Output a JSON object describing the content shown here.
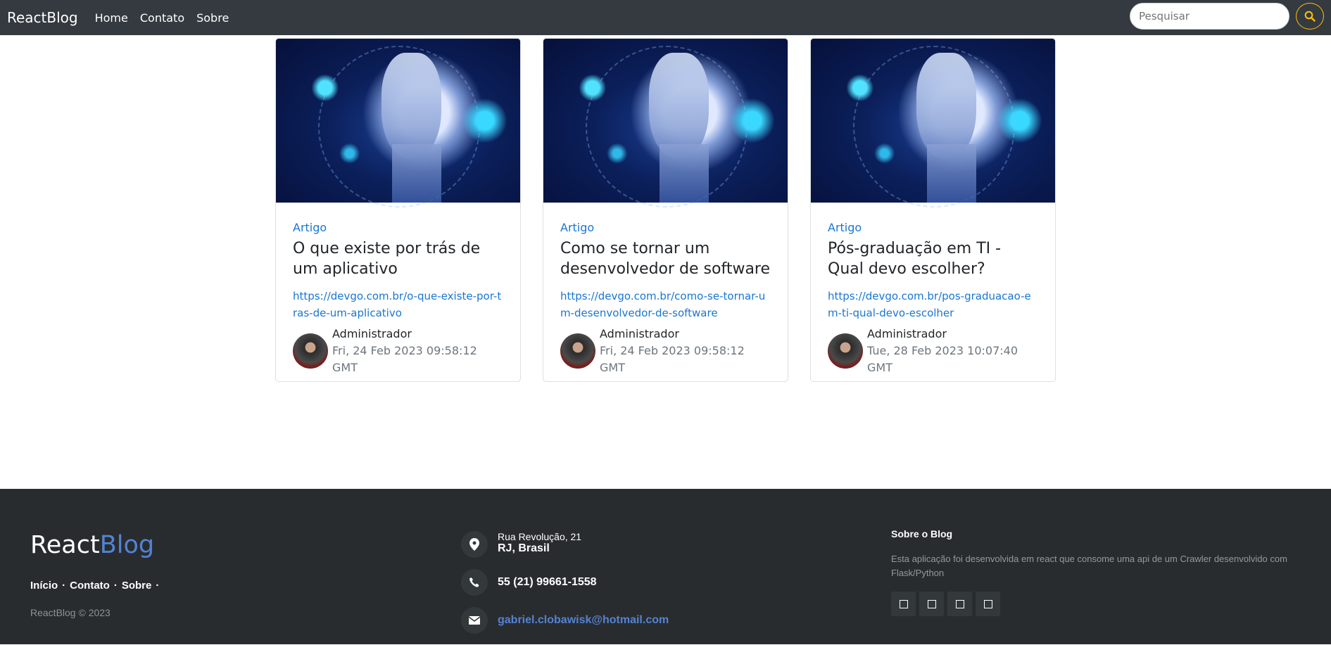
{
  "navbar": {
    "brand": "ReactBlog",
    "links": [
      "Home",
      "Contato",
      "Sobre"
    ],
    "search_placeholder": "Pesquisar",
    "search_button_icon": "search-icon",
    "search_button_color": "#ffc107"
  },
  "cards": [
    {
      "category": "Artigo",
      "title": "O que existe por trás de um aplicativo",
      "link": "https://devgo.com.br/o-que-existe-por-tras-de-um-aplicativo",
      "author": "Administrador",
      "date": "Fri, 24 Feb 2023 09:58:12 GMT"
    },
    {
      "category": "Artigo",
      "title": "Como se tornar um desenvolvedor de software",
      "link": "https://devgo.com.br/como-se-tornar-um-desenvolvedor-de-software",
      "author": "Administrador",
      "date": "Fri, 24 Feb 2023 09:58:12 GMT"
    },
    {
      "category": "Artigo",
      "title": "Pós-graduação em TI - Qual devo escolher?",
      "link": "https://devgo.com.br/pos-graduacao-em-ti-qual-devo-escolher",
      "author": "Administrador",
      "date": "Tue, 28 Feb 2023 10:07:40 GMT"
    }
  ],
  "footer": {
    "logo_part1": "React",
    "logo_part2": "Blog",
    "links": [
      "Início",
      "Contato",
      "Sobre"
    ],
    "copyright": "ReactBlog © 2023",
    "address_line1": "Rua Revolução, 21",
    "address_line2": "RJ, Brasil",
    "phone": "55 (21) 99661-1558",
    "email": "gabriel.clobawisk@hotmail.com",
    "about_title": "Sobre o Blog",
    "about_text": "Esta aplicação foi desenvolvida em react que consome uma api de um Crawler desenvolvido com Flask/Python",
    "social_icons": [
      "social-icon-1",
      "social-icon-2",
      "social-icon-3",
      "social-icon-4"
    ],
    "accent_color": "#5383d3"
  }
}
